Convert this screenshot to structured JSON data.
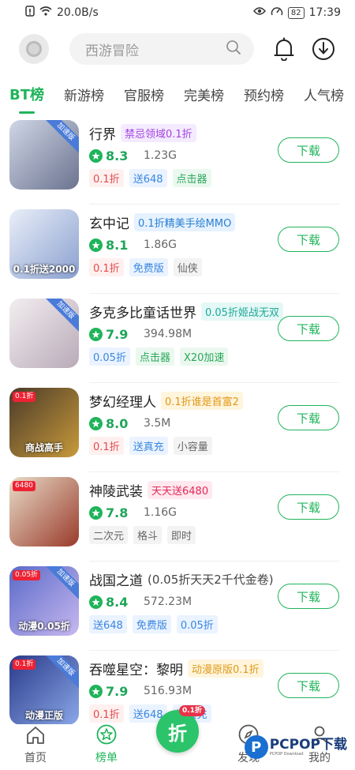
{
  "status_bar": {
    "speed": "20.0B/s",
    "battery": "82",
    "time": "17:39"
  },
  "search": {
    "placeholder": "西游冒险"
  },
  "tabs": [
    "BT榜",
    "新游榜",
    "官服榜",
    "完美榜",
    "预约榜",
    "人气榜"
  ],
  "download_label": "下载",
  "games": [
    {
      "name": "行界",
      "promo": "禁忌领域0.1折",
      "promo_style": "purple",
      "rating": "8.3",
      "size": "1.23G",
      "tags": [
        {
          "t": "0.1折",
          "s": "red"
        },
        {
          "t": "送648",
          "s": "blue"
        },
        {
          "t": "点击器",
          "s": "green"
        }
      ],
      "thumb_tag": "加速版",
      "thumb_colors": [
        "#cfd6e6",
        "#6b7390"
      ]
    },
    {
      "name": "玄中记",
      "promo": "0.1折精美手绘MMO",
      "promo_style": "blue",
      "rating": "8.1",
      "size": "1.86G",
      "tags": [
        {
          "t": "0.1折",
          "s": "red"
        },
        {
          "t": "免费版",
          "s": "blue"
        },
        {
          "t": "仙侠",
          "s": "gray"
        }
      ],
      "thumb_text": "0.1折送2000",
      "thumb_colors": [
        "#e9eef8",
        "#8aa0cf"
      ]
    },
    {
      "name": "多克多比童话世界",
      "promo": "0.05折姬战无双",
      "promo_style": "teal",
      "rating": "7.9",
      "size": "394.98M",
      "tags": [
        {
          "t": "0.05折",
          "s": "blue"
        },
        {
          "t": "点击器",
          "s": "green"
        },
        {
          "t": "X20加速",
          "s": "green"
        }
      ],
      "thumb_tag": "加速版",
      "thumb_colors": [
        "#f2eef0",
        "#b9aab8"
      ]
    },
    {
      "name": "梦幻经理人",
      "promo": "0.1折谁是首富2",
      "promo_style": "orange",
      "rating": "8.0",
      "size": "3.5M",
      "tags": [
        {
          "t": "0.1折",
          "s": "red"
        },
        {
          "t": "送真充",
          "s": "blue"
        },
        {
          "t": "小容量",
          "s": "gray"
        }
      ],
      "thumb_tag_l": "0.1折",
      "thumb_text": "商战高手",
      "thumb_colors": [
        "#4a3a2a",
        "#c89a3a"
      ]
    },
    {
      "name": "神陵武装",
      "promo": "天天送6480",
      "promo_style": "red",
      "rating": "7.8",
      "size": "1.16G",
      "tags": [
        {
          "t": "二次元",
          "s": "gray"
        },
        {
          "t": "格斗",
          "s": "gray"
        },
        {
          "t": "即时",
          "s": "gray"
        }
      ],
      "thumb_tag_l": "6480",
      "thumb_colors": [
        "#e8dcc8",
        "#9a3a2a"
      ]
    },
    {
      "name": "战国之道",
      "promo": "(0.05折天天2千代金卷)",
      "promo_style": "plain",
      "rating": "8.4",
      "size": "572.23M",
      "tags": [
        {
          "t": "送648",
          "s": "blue"
        },
        {
          "t": "免费版",
          "s": "blue"
        },
        {
          "t": "0.05折",
          "s": "blue"
        }
      ],
      "thumb_tag_l": "0.05折",
      "thumb_tag": "加速版",
      "thumb_text": "动漫0.05折",
      "thumb_colors": [
        "#5a6ac8",
        "#c8b8f0"
      ]
    },
    {
      "name": "吞噬星空：黎明",
      "promo": "动漫原版0.1折",
      "promo_style": "orange",
      "rating": "7.9",
      "size": "516.93M",
      "tags": [
        {
          "t": "0.1折",
          "s": "red"
        },
        {
          "t": "送648",
          "s": "blue"
        },
        {
          "t": "送真充",
          "s": "blue"
        }
      ],
      "thumb_tag_l": "0.1折",
      "thumb_tag": "加速版",
      "thumb_text": "动漫正版",
      "thumb_colors": [
        "#2a3a8a",
        "#8aa8e8"
      ]
    }
  ],
  "bottom_nav": [
    {
      "label": "首页",
      "icon": "home-icon"
    },
    {
      "label": "榜单",
      "icon": "star-icon"
    },
    {
      "label": "发现",
      "icon": "compass-icon"
    },
    {
      "label": "我的",
      "icon": "user-icon"
    }
  ],
  "fab": {
    "label": "折",
    "badge": "0.1折"
  },
  "watermark": {
    "text": "PCPOP下载",
    "sub": "PCPOP Download"
  },
  "colors": {
    "accent": "#1fb45a"
  }
}
